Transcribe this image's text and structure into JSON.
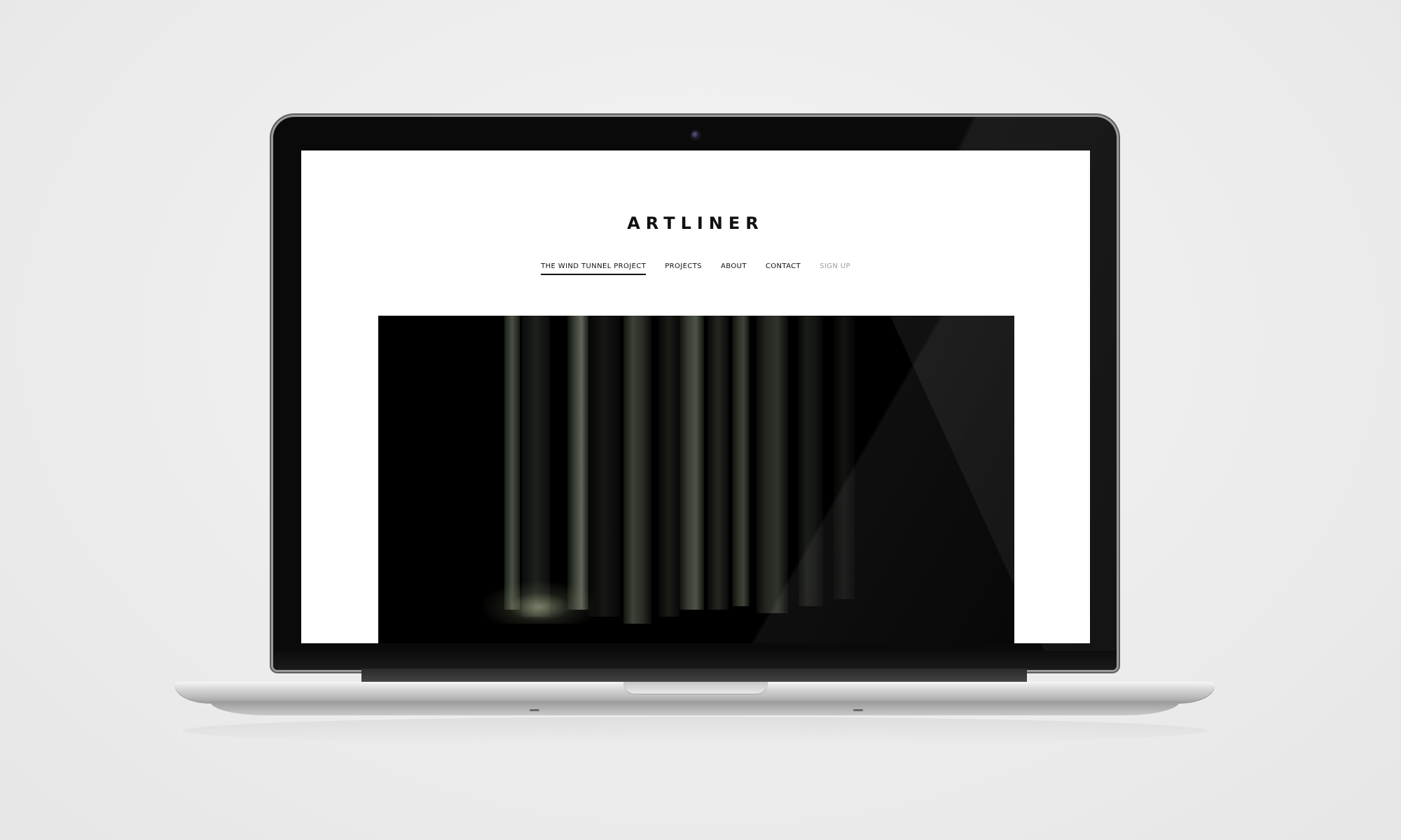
{
  "site": {
    "logo": "ARTLINER",
    "nav": [
      {
        "label": "THE WIND TUNNEL PROJECT",
        "active": true
      },
      {
        "label": "PROJECTS",
        "active": false
      },
      {
        "label": "ABOUT",
        "active": false
      },
      {
        "label": "CONTACT",
        "active": false
      },
      {
        "label": "SIGN UP",
        "active": false,
        "muted": true
      }
    ]
  },
  "colors": {
    "text": "#111111",
    "muted": "#9a9a9a",
    "background": "#ffffff",
    "hero": "#000000"
  }
}
